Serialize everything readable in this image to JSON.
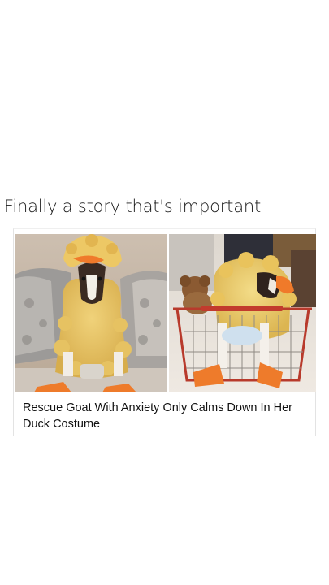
{
  "post": {
    "caption": "Finally a story that's important"
  },
  "article_card": {
    "headline": "Rescue Goat With Anxiety Only Calms Down In Her Duck Costume",
    "photos": [
      {
        "name": "goat-in-duck-costume-on-couch"
      },
      {
        "name": "goat-in-duck-costume-in-shopping-cart"
      }
    ]
  },
  "colors": {
    "background": "#ffffff",
    "costume_yellow": "#e8c866",
    "beak_orange": "#f07a2a",
    "cart_red": "#c0392b"
  }
}
